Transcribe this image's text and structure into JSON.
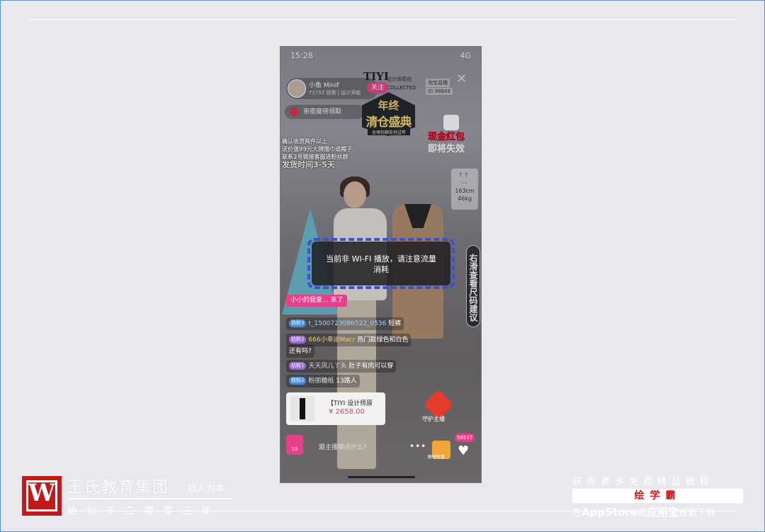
{
  "phone": {
    "status": {
      "time": "15:28",
      "network": "4G"
    },
    "room": {
      "name": "小鱼 Minif",
      "sub": "71752 观看 | 设计师款",
      "follow": "关注"
    },
    "brand": {
      "name": "TIYI",
      "sub1": "设计师原创",
      "sub2": "COLLECTED",
      "taobao": "淘宝直播",
      "id": "ID 98849"
    },
    "intimacy": "亲密度待领取",
    "banner": {
      "line1": "年终",
      "line2": "清仓盛典",
      "line3": "全场包邮实付过年"
    },
    "redpacket": {
      "line1": "现金红包",
      "line2": "即将失效"
    },
    "notice": {
      "l1": "确认收货两件以上",
      "l2": "送价值99元大牌围巾或帽子",
      "l3": "联系2号链接客服进粉丝群",
      "l4": "发货时间3-5天"
    },
    "size_tag": {
      "l1": "？？",
      "l2": "···",
      "l3": "163cm",
      "l4": "46kg"
    },
    "vertical": "右滑查看尺码建议",
    "toast": {
      "line1": "当前非 WI-FI 播放，请注意流量",
      "line2": "消耗"
    },
    "welcome": "小小的我爱... 来了",
    "chats": [
      {
        "level": "铁粉3",
        "user": "t_1500723086522_0536",
        "text": "短裤"
      },
      {
        "level": "钻粉2",
        "user": "666小幸运Macr",
        "text": "热门款绿色和白色"
      },
      {
        "level": "",
        "user": "",
        "text": "还有吗?"
      },
      {
        "level": "钻粉1",
        "user": "天天凤儿丫头",
        "text": "肚子有肉可以穿"
      },
      {
        "level": "铁粉2",
        "user": "粉丽糖纸",
        "text": "13路人"
      }
    ],
    "product": {
      "name": "【TIYI 设计师原",
      "price": "¥ 2658.00"
    },
    "bag_count": "19",
    "input_placeholder": "跟主播聊点什么?",
    "more": "•••",
    "guard": "守护主播",
    "likes": "59537",
    "gift": "解锁惊喜"
  },
  "footer": {
    "logo_letter": "W",
    "company": "王氏教育集团",
    "slogan": "以人为本",
    "since": "始创于二零零三年",
    "promo1": "获得更多免费精品教程",
    "app": "绘学霸",
    "promo2_pre": "在",
    "promo2_store": "AppStore",
    "promo2_mid": "或",
    "promo2_market": "应用宝",
    "promo2_post": "搜索下载"
  }
}
